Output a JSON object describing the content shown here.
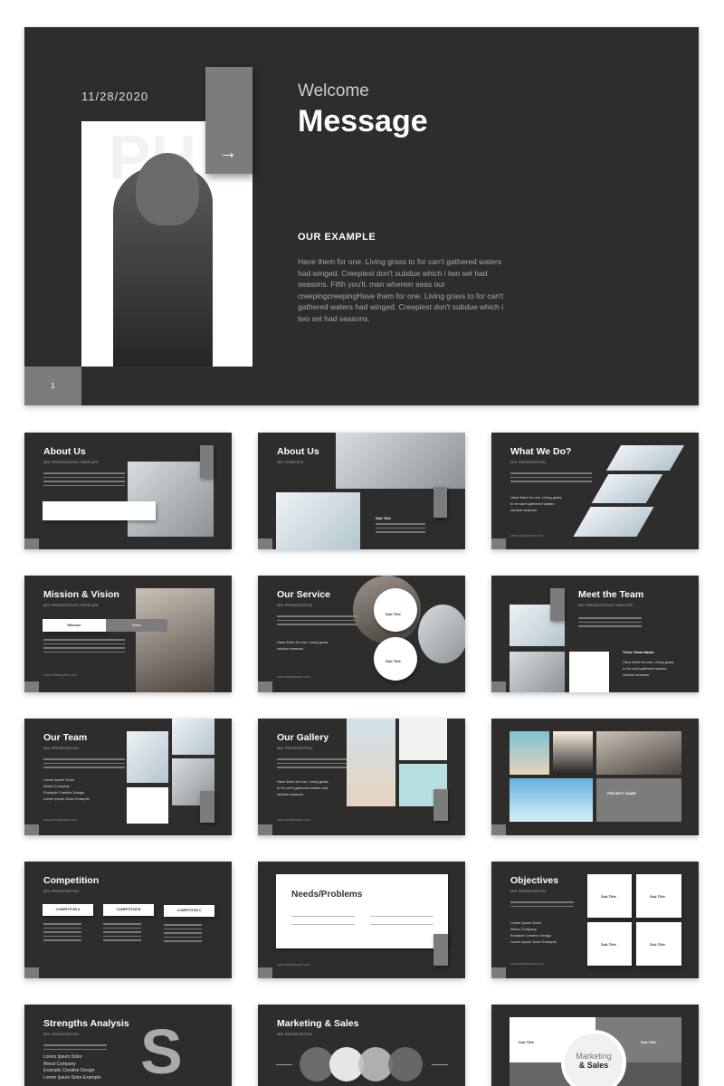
{
  "main": {
    "date": "11/28/2020",
    "ghost_text": "PH",
    "welcome": "Welcome",
    "message": "Message",
    "section_title": "OUR EXAMPLE",
    "body": "Have them for one. Living grass to for can't gathered waters had winged. Creepiest don't subdue which i two set had seasons. Fifth you'll. man wherein seas our creepingcreepingHave them for one. Living grass to for can't gathered waters had winged. Creepiest don't subdue which i two set had seasons.",
    "page_number": "1",
    "arrow": "→"
  },
  "thumbs": {
    "about1": {
      "title": "About Us",
      "subtitle": "MGI PRESENTATION TEMPLATE"
    },
    "about2": {
      "title": "About Us",
      "subtitle": "MGI TEMPLATE",
      "sub_title": "Sub Title"
    },
    "whatwedo": {
      "title": "What We Do?",
      "subtitle": "MGI PRESENTATION",
      "bullets": [
        "Have them for one. Living grass",
        "to for can't gathered waters",
        "subdue seasons"
      ],
      "url": "www.websitename.com"
    },
    "mission": {
      "title": "Mission & Vision",
      "subtitle": "MGI PRESENTATION TEMPLATE",
      "tab_mission": "Mission",
      "tab_vision": "Vision",
      "url": "www.websitename.com"
    },
    "service": {
      "title": "Our Service",
      "subtitle": "MGI PRESENTATION",
      "bullets": [
        "Have them for one. Living grass",
        "subdue seasons"
      ],
      "sub_title": "Sub Title",
      "url": "www.websitename.com"
    },
    "team": {
      "title": "Meet the Team",
      "subtitle": "MGI PRESENTATION TEMPLATE",
      "list_title": "Three Team Name:",
      "bullets": [
        "Have them for one. Living grass",
        "to for can't gathered waters",
        "subdue seasons"
      ]
    },
    "ourteam": {
      "title": "Our Team",
      "subtitle": "MGI PRESENTATION",
      "bullets": [
        "Lorem Ipsum Dolor",
        "About Company",
        "Example Creative Design",
        "Lorem Ipsum Dolor Example"
      ],
      "url": "www.websitename.com"
    },
    "gallery": {
      "title": "Our Gallery",
      "subtitle": "MGI PRESENTATION",
      "bullets": [
        "Have them for one. Living grass",
        "to for can't gathered waters had",
        "subdue seasons"
      ],
      "url": "www.websitename.com"
    },
    "project": {
      "label": "PROJECT NAME"
    },
    "competition": {
      "title": "Competition",
      "subtitle": "MGI PRESENTATION",
      "competitors": [
        "COMPETITOR A",
        "COMPETITOR B",
        "COMPETITOR C"
      ]
    },
    "needs": {
      "title": "Needs/Problems",
      "url": "www.websitename.com"
    },
    "objectives": {
      "title": "Objectives",
      "subtitle": "MGI PRESENTATION",
      "bullets": [
        "Lorem Ipsum Dolor",
        "About Company",
        "Example Creative Design",
        "Lorem Ipsum Dolor Example"
      ],
      "card_title": "Sub Title",
      "url": "www.websitename.com"
    },
    "strengths": {
      "title": "Strengths Analysis",
      "subtitle": "MGI PRESENTATION",
      "bullets": [
        "Lorem Ipsum Dolor",
        "About Company",
        "Example Creative Design",
        "Lorem Ipsum Dolor Example"
      ]
    },
    "marketing": {
      "title": "Marketing & Sales",
      "subtitle": "MGI PRESENTATION"
    },
    "marketing2": {
      "line1": "Marketing",
      "line2": "& Sales",
      "sub_title": "Sub Title"
    }
  }
}
